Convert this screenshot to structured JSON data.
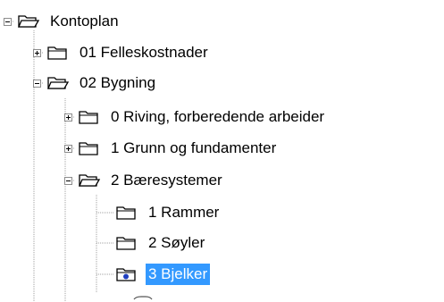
{
  "tree": {
    "root": {
      "label": "Kontoplan",
      "state": "expanded"
    },
    "items": [
      {
        "label": "01 Felleskostnader",
        "state": "collapsed",
        "level": 1
      },
      {
        "label": "02 Bygning",
        "state": "expanded",
        "level": 1
      },
      {
        "label": "0 Riving, forberedende arbeider",
        "state": "collapsed",
        "level": 2
      },
      {
        "label": "1 Grunn og fundamenter",
        "state": "collapsed",
        "level": 2
      },
      {
        "label": "2 Bæresystemer",
        "state": "expanded",
        "level": 2
      },
      {
        "label": "1 Rammer",
        "state": "leaf",
        "level": 3
      },
      {
        "label": "2 Søyler",
        "state": "leaf",
        "level": 3
      },
      {
        "label": "3 Bjelker",
        "state": "leaf",
        "level": 3,
        "selected": true
      }
    ]
  },
  "colors": {
    "selection": "#3399ff",
    "tree_lines": "#a0a0a0",
    "folder_outline": "#000000",
    "radio_dot": "#1f3fbf"
  },
  "icons": {
    "collapsed_folder": "folder-icon",
    "expanded_folder": "folder-open-icon",
    "selected_leaf": "folder-selected-icon"
  }
}
